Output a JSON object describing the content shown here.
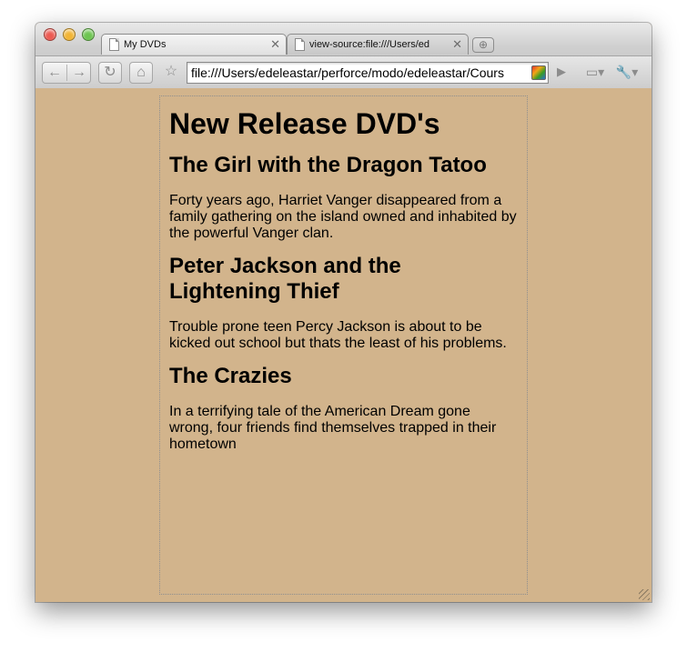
{
  "browser": {
    "tabs": [
      {
        "label": "My DVDs",
        "active": true
      },
      {
        "label": "view-source:file:///Users/ed",
        "active": false
      }
    ],
    "url": "file:///Users/edeleastar/perforce/modo/edeleastar/Cours",
    "colors": {
      "close": "#ec5b53",
      "minimize": "#f2b536",
      "zoom": "#6dc551"
    },
    "icons": {
      "back": "back-arrow-icon",
      "forward": "forward-arrow-icon",
      "reload": "reload-icon",
      "home": "home-icon",
      "bookmark": "star-icon",
      "extension": "extension-icon",
      "go": "play-icon",
      "page_menu": "page-menu-icon",
      "wrench_menu": "wrench-icon"
    }
  },
  "page": {
    "background": "#d2b48c",
    "heading": "New Release DVD's",
    "dvds": [
      {
        "title": "The Girl with the Dragon Tatoo",
        "description": "Forty years ago, Harriet Vanger disappeared from a family gathering on the island owned and inhabited by the powerful Vanger clan."
      },
      {
        "title": "Peter Jackson and the Lightening Thief",
        "description": "Trouble prone teen Percy Jackson is about to be kicked out school but thats the least of his problems."
      },
      {
        "title": "The Crazies",
        "description": "In a terrifying tale of the American Dream gone wrong, four friends find themselves trapped in their hometown"
      }
    ]
  }
}
